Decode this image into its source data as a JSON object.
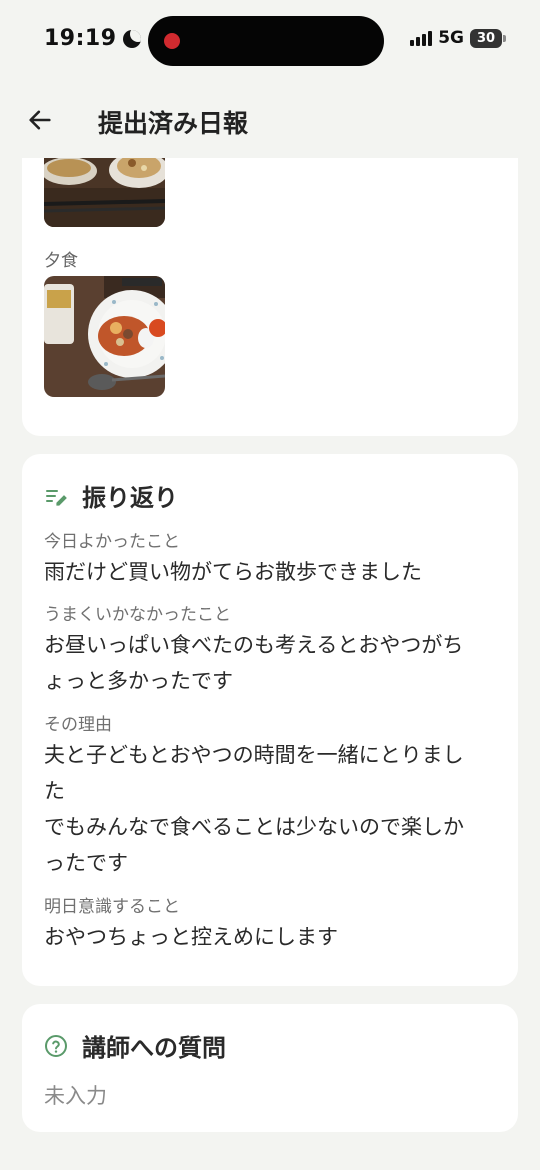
{
  "status": {
    "time": "19:19",
    "network": "5G",
    "battery": "30"
  },
  "header": {
    "title": "提出済み日報"
  },
  "meals": {
    "dinner_label": "夕食"
  },
  "reflection": {
    "title": "振り返り",
    "good_label": "今日よかったこと",
    "good_value": "雨だけど買い物がてらお散歩できました",
    "bad_label": "うまくいかなかったこと",
    "bad_value_line1": "お昼いっぱい食べたのも考えるとおやつがち",
    "bad_value_line2": "ょっと多かったです",
    "reason_label": "その理由",
    "reason_line1": "夫と子どもとおやつの時間を一緒にとりまし",
    "reason_line2": "た",
    "reason_line3": "でもみんなで食べることは少ないので楽しか",
    "reason_line4": "ったです",
    "tomorrow_label": "明日意識すること",
    "tomorrow_value": "おやつちょっと控えめにします"
  },
  "question": {
    "title": "講師への質問",
    "value": "未入力"
  },
  "colors": {
    "accent": "#5a9a6a",
    "background": "#f3f4f1",
    "card": "#ffffff"
  },
  "icons": {
    "back": "arrow-left-icon",
    "reflection": "notes-edit-icon",
    "question": "question-circle-icon",
    "night": "moon-icon"
  }
}
